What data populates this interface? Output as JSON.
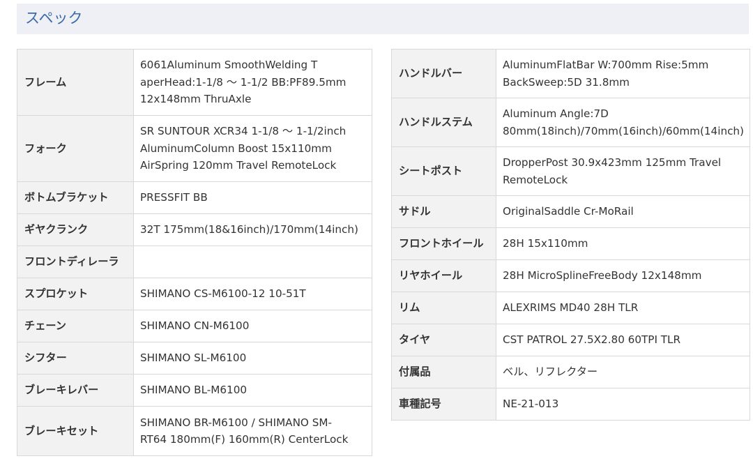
{
  "section_title": "スペック",
  "left_table": [
    {
      "label": "フレーム",
      "lines": [
        "6061Aluminum SmoothWelding T",
        "aperHead:1-1/8 〜 1-1/2 BB:PF89.5mm",
        "12x148mm ThruAxle"
      ]
    },
    {
      "label": "フォーク",
      "lines": [
        "SR SUNTOUR XCR34 1-1/8 〜 1-1/2inch",
        "AluminumColumn Boost 15x110mm",
        "AirSpring 120mm Travel RemoteLock"
      ]
    },
    {
      "label": "ボトムブラケット",
      "lines": [
        "PRESSFIT BB"
      ]
    },
    {
      "label": "ギヤクランク",
      "lines": [
        "32T 175mm(18&16inch)/170mm(14inch)"
      ]
    },
    {
      "label": "フロントディレーラ",
      "lines": [
        ""
      ]
    },
    {
      "label": "スプロケット",
      "lines": [
        "SHIMANO CS-M6100-12 10-51T"
      ]
    },
    {
      "label": "チェーン",
      "lines": [
        "SHIMANO CN-M6100"
      ]
    },
    {
      "label": "シフター",
      "lines": [
        "SHIMANO SL-M6100"
      ]
    },
    {
      "label": "ブレーキレバー",
      "lines": [
        "SHIMANO BL-M6100"
      ]
    },
    {
      "label": "ブレーキセット",
      "lines": [
        "SHIMANO BR-M6100 / SHIMANO SM-",
        "RT64 180mm(F) 160mm(R) CenterLock"
      ]
    }
  ],
  "right_table": [
    {
      "label": "ハンドルバー",
      "lines": [
        "AluminumFlatBar W:700mm Rise:5mm",
        "BackSweep:5D 31.8mm"
      ]
    },
    {
      "label": "ハンドルステム",
      "lines": [
        "Aluminum Angle:7D",
        "80mm(18inch)/70mm(16inch)/60mm(14inch)"
      ]
    },
    {
      "label": "シートポスト",
      "lines": [
        "DropperPost 30.9x423mm 125mm Travel",
        "RemoteLock"
      ]
    },
    {
      "label": "サドル",
      "lines": [
        "OriginalSaddle Cr-MoRail"
      ]
    },
    {
      "label": "フロントホイール",
      "lines": [
        "28H 15x110mm"
      ]
    },
    {
      "label": "リヤホイール",
      "lines": [
        "28H MicroSplineFreeBody 12x148mm"
      ]
    },
    {
      "label": "リム",
      "lines": [
        "ALEXRIMS MD40 28H TLR"
      ]
    },
    {
      "label": "タイヤ",
      "lines": [
        "CST PATROL 27.5X2.80 60TPI TLR"
      ]
    },
    {
      "label": "付属品",
      "lines": [
        "ベル、リフレクター"
      ]
    },
    {
      "label": "車種記号",
      "lines": [
        "NE-21-013"
      ]
    }
  ],
  "colors": {
    "heading_bg": "#eef0f5",
    "heading_text": "#3c6aa6",
    "label_bg": "#f2f2f2",
    "border": "#d8d8d8"
  }
}
